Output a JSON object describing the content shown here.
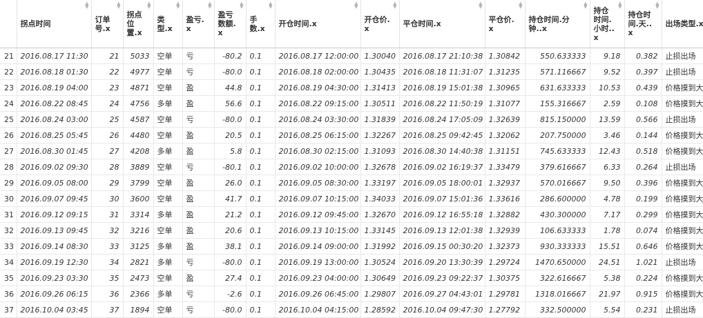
{
  "columns": [
    {
      "label": "",
      "type": "idx"
    },
    {
      "label": "拐点时间",
      "type": "left"
    },
    {
      "label": "订单号.x",
      "type": "num"
    },
    {
      "label": "拐点位置.x",
      "type": "num"
    },
    {
      "label": "类型.x",
      "type": "txt"
    },
    {
      "label": "盈亏.x",
      "type": "txt"
    },
    {
      "label": "盈亏数额.x",
      "type": "num"
    },
    {
      "label": "手数.x",
      "type": "left"
    },
    {
      "label": "开仓时间.x",
      "type": "left"
    },
    {
      "label": "开仓价.x",
      "type": "left"
    },
    {
      "label": "平仓时间.x",
      "type": "left"
    },
    {
      "label": "平仓价.x",
      "type": "left"
    },
    {
      "label": "持仓时间.分钟..x",
      "type": "num"
    },
    {
      "label": "持仓时间.小时..x",
      "type": "num"
    },
    {
      "label": "持仓时间.天..x",
      "type": "num"
    },
    {
      "label": "出场类型.x",
      "type": "txt"
    }
  ],
  "rows": [
    [
      "21",
      "2016.08.17 11:30",
      "21",
      "5033",
      "空单",
      "亏",
      "-80.2",
      "0.1",
      "2016.08.17 12:00:00",
      "1.30040",
      "2016.08.17 21:10:38",
      "1.30842",
      "550.633333",
      "9.18",
      "0.382",
      "止损出场"
    ],
    [
      "22",
      "2016.08.18 01:30",
      "22",
      "4977",
      "空单",
      "亏",
      "-80.0",
      "0.1",
      "2016.08.18 02:00:00",
      "1.30435",
      "2016.08.18 11:31:07",
      "1.31235",
      "571.116667",
      "9.52",
      "0.397",
      "止损出场"
    ],
    [
      "23",
      "2016.08.19 04:00",
      "23",
      "4871",
      "空单",
      "盈",
      "44.8",
      "0.1",
      "2016.08.19 04:30:00",
      "1.31413",
      "2016.08.19 15:01:38",
      "1.30965",
      "631.633333",
      "10.53",
      "0.439",
      "价格摸到大周"
    ],
    [
      "24",
      "2016.08.22 08:45",
      "24",
      "4756",
      "多单",
      "盈",
      "56.6",
      "0.1",
      "2016.08.22 09:15:00",
      "1.30511",
      "2016.08.22 11:50:19",
      "1.31077",
      "155.316667",
      "2.59",
      "0.108",
      "价格摸到大周"
    ],
    [
      "25",
      "2016.08.24 03:00",
      "25",
      "4587",
      "空单",
      "亏",
      "-80.0",
      "0.1",
      "2016.08.24 03:30:00",
      "1.31839",
      "2016.08.24 17:05:09",
      "1.32639",
      "815.150000",
      "13.59",
      "0.566",
      "止损出场"
    ],
    [
      "26",
      "2016.08.25 05:45",
      "26",
      "4480",
      "空单",
      "盈",
      "20.5",
      "0.1",
      "2016.08.25 06:15:00",
      "1.32267",
      "2016.08.25 09:42:45",
      "1.32062",
      "207.750000",
      "3.46",
      "0.144",
      "价格摸到大周"
    ],
    [
      "27",
      "2016.08.30 01:45",
      "27",
      "4208",
      "多单",
      "盈",
      "5.8",
      "0.1",
      "2016.08.30 02:15:00",
      "1.31093",
      "2016.08.30 14:40:38",
      "1.31151",
      "745.633333",
      "12.43",
      "0.518",
      "价格摸到大周"
    ],
    [
      "28",
      "2016.09.02 09:30",
      "28",
      "3889",
      "空单",
      "亏",
      "-80.1",
      "0.1",
      "2016.09.02 10:00:00",
      "1.32678",
      "2016.09.02 16:19:37",
      "1.33479",
      "379.616667",
      "6.33",
      "0.264",
      "止损出场"
    ],
    [
      "29",
      "2016.09.05 08:00",
      "29",
      "3799",
      "空单",
      "盈",
      "26.0",
      "0.1",
      "2016.09.05 08:30:00",
      "1.33197",
      "2016.09.05 18:00:01",
      "1.32937",
      "570.016667",
      "9.50",
      "0.396",
      "价格摸到大周"
    ],
    [
      "30",
      "2016.09.07 09:45",
      "30",
      "3600",
      "空单",
      "盈",
      "41.7",
      "0.1",
      "2016.09.07 10:15:00",
      "1.34033",
      "2016.09.07 15:01:36",
      "1.33616",
      "286.600000",
      "4.78",
      "0.199",
      "价格摸到大周"
    ],
    [
      "31",
      "2016.09.12 09:15",
      "31",
      "3314",
      "多单",
      "盈",
      "21.2",
      "0.1",
      "2016.09.12 09:45:00",
      "1.32670",
      "2016.09.12 16:55:18",
      "1.32882",
      "430.300000",
      "7.17",
      "0.299",
      "价格摸到大周"
    ],
    [
      "32",
      "2016.09.13 09:45",
      "32",
      "3216",
      "空单",
      "盈",
      "20.6",
      "0.1",
      "2016.09.13 10:15:00",
      "1.33145",
      "2016.09.13 12:01:38",
      "1.32939",
      "106.633333",
      "1.78",
      "0.074",
      "价格摸到大周"
    ],
    [
      "33",
      "2016.09.14 08:30",
      "33",
      "3125",
      "多单",
      "盈",
      "38.1",
      "0.1",
      "2016.09.14 09:00:00",
      "1.31992",
      "2016.09.15 00:30:20",
      "1.32373",
      "930.333333",
      "15.51",
      "0.646",
      "价格摸到大周"
    ],
    [
      "34",
      "2016.09.19 12:30",
      "34",
      "2821",
      "多单",
      "亏",
      "-80.0",
      "0.1",
      "2016.09.19 13:00:00",
      "1.30524",
      "2016.09.20 13:30:39",
      "1.29724",
      "1470.650000",
      "24.51",
      "1.021",
      "止损出场"
    ],
    [
      "35",
      "2016.09.23 03:30",
      "35",
      "2473",
      "空单",
      "盈",
      "27.4",
      "0.1",
      "2016.09.23 04:00:00",
      "1.30649",
      "2016.09.23 09:22:37",
      "1.30375",
      "322.616667",
      "5.38",
      "0.224",
      "价格摸到大周"
    ],
    [
      "36",
      "2016.09.26 06:15",
      "36",
      "2366",
      "多单",
      "亏",
      "-2.6",
      "0.1",
      "2016.09.26 06:45:00",
      "1.29807",
      "2016.09.27 04:43:01",
      "1.29781",
      "1318.016667",
      "21.97",
      "0.915",
      "价格摸到大周"
    ],
    [
      "37",
      "2016.10.04 03:45",
      "37",
      "1894",
      "空单",
      "亏",
      "-80.0",
      "0.1",
      "2016.10.04 04:15:00",
      "1.28592",
      "2016.10.04 09:47:30",
      "1.27792",
      "332.500000",
      "5.54",
      "0.231",
      "止损出场"
    ]
  ],
  "sort_icon": "sort-arrows-icon"
}
